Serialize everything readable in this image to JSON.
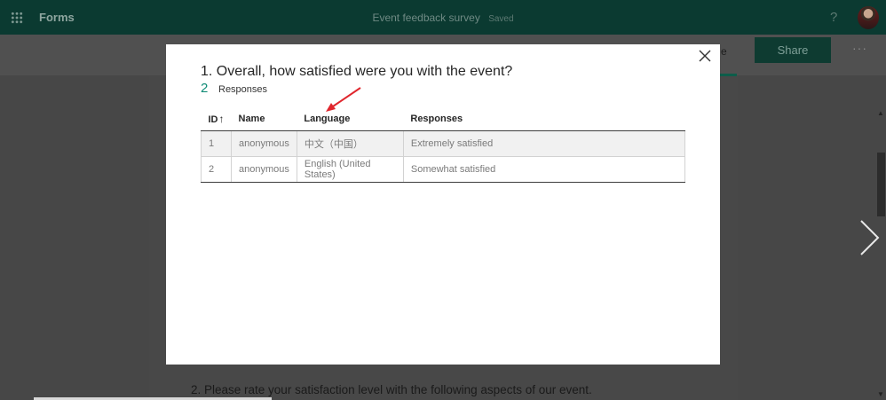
{
  "topbar": {
    "app_name": "Forms",
    "doc_title": "Event feedback survey",
    "doc_status": "Saved",
    "help_label": "?"
  },
  "header": {
    "share_label": "Share",
    "more_label": "···",
    "tab_fragment": "e"
  },
  "background": {
    "question2": "2.  Please rate your satisfaction level with the following aspects of our event."
  },
  "modal": {
    "question": "1. Overall, how satisfied were you with the event?",
    "response_count": "2",
    "response_label": "Responses",
    "table": {
      "headers": [
        "ID",
        "Name",
        "Language",
        "Responses"
      ],
      "sort_indicator": "↑",
      "rows": [
        [
          "1",
          "anonymous",
          "中文（中国）",
          "Extremely satisfied"
        ],
        [
          "2",
          "anonymous",
          "English (United States)",
          "Somewhat satisfied"
        ]
      ]
    }
  },
  "colors": {
    "topbar": "#0b3a31",
    "accent": "#0f8b76",
    "annotation_arrow": "#e0262d"
  }
}
